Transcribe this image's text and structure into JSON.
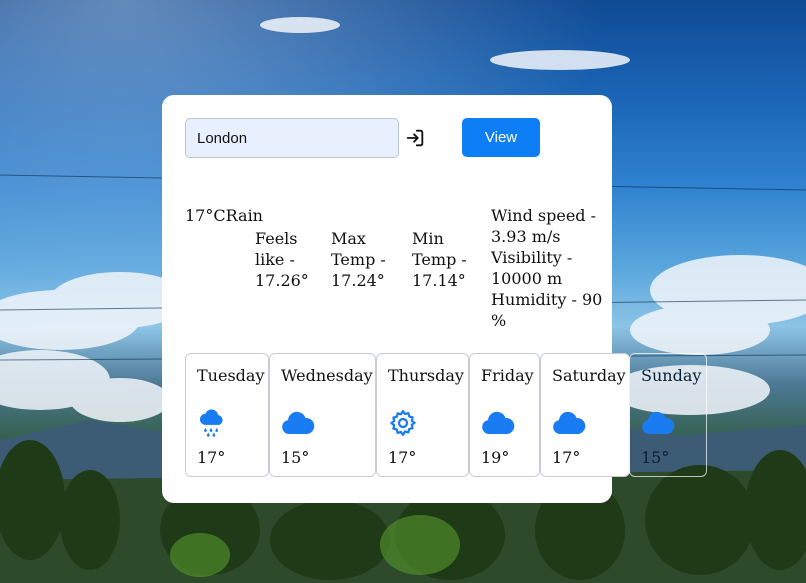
{
  "search": {
    "value": "London",
    "button_label": "View"
  },
  "current": {
    "temp": "17°C",
    "description": "Rain",
    "feels_like": "Feels like - 17.26°",
    "max_temp": "Max Temp - 17.24°",
    "min_temp": "Min Temp - 17.14°",
    "wind_speed": "Wind speed - 3.93 m/s",
    "visibility": "Visibility - 10000 m",
    "humidity": "Humidity - 90 %"
  },
  "forecast": [
    {
      "day": "Tuesday",
      "temp": "17°",
      "icon": "rain-cloud-icon"
    },
    {
      "day": "Wednesday",
      "temp": "15°",
      "icon": "cloud-icon"
    },
    {
      "day": "Thursday",
      "temp": "17°",
      "icon": "gear-icon"
    },
    {
      "day": "Friday",
      "temp": "19°",
      "icon": "cloud-icon"
    },
    {
      "day": "Saturday",
      "temp": "17°",
      "icon": "cloud-icon"
    },
    {
      "day": "Sunday",
      "temp": "15°",
      "icon": "cloud-icon"
    }
  ],
  "colors": {
    "accent": "#0d7ef6",
    "icon_blue": "#1a7cf3",
    "input_bg": "#e8f0fe"
  }
}
